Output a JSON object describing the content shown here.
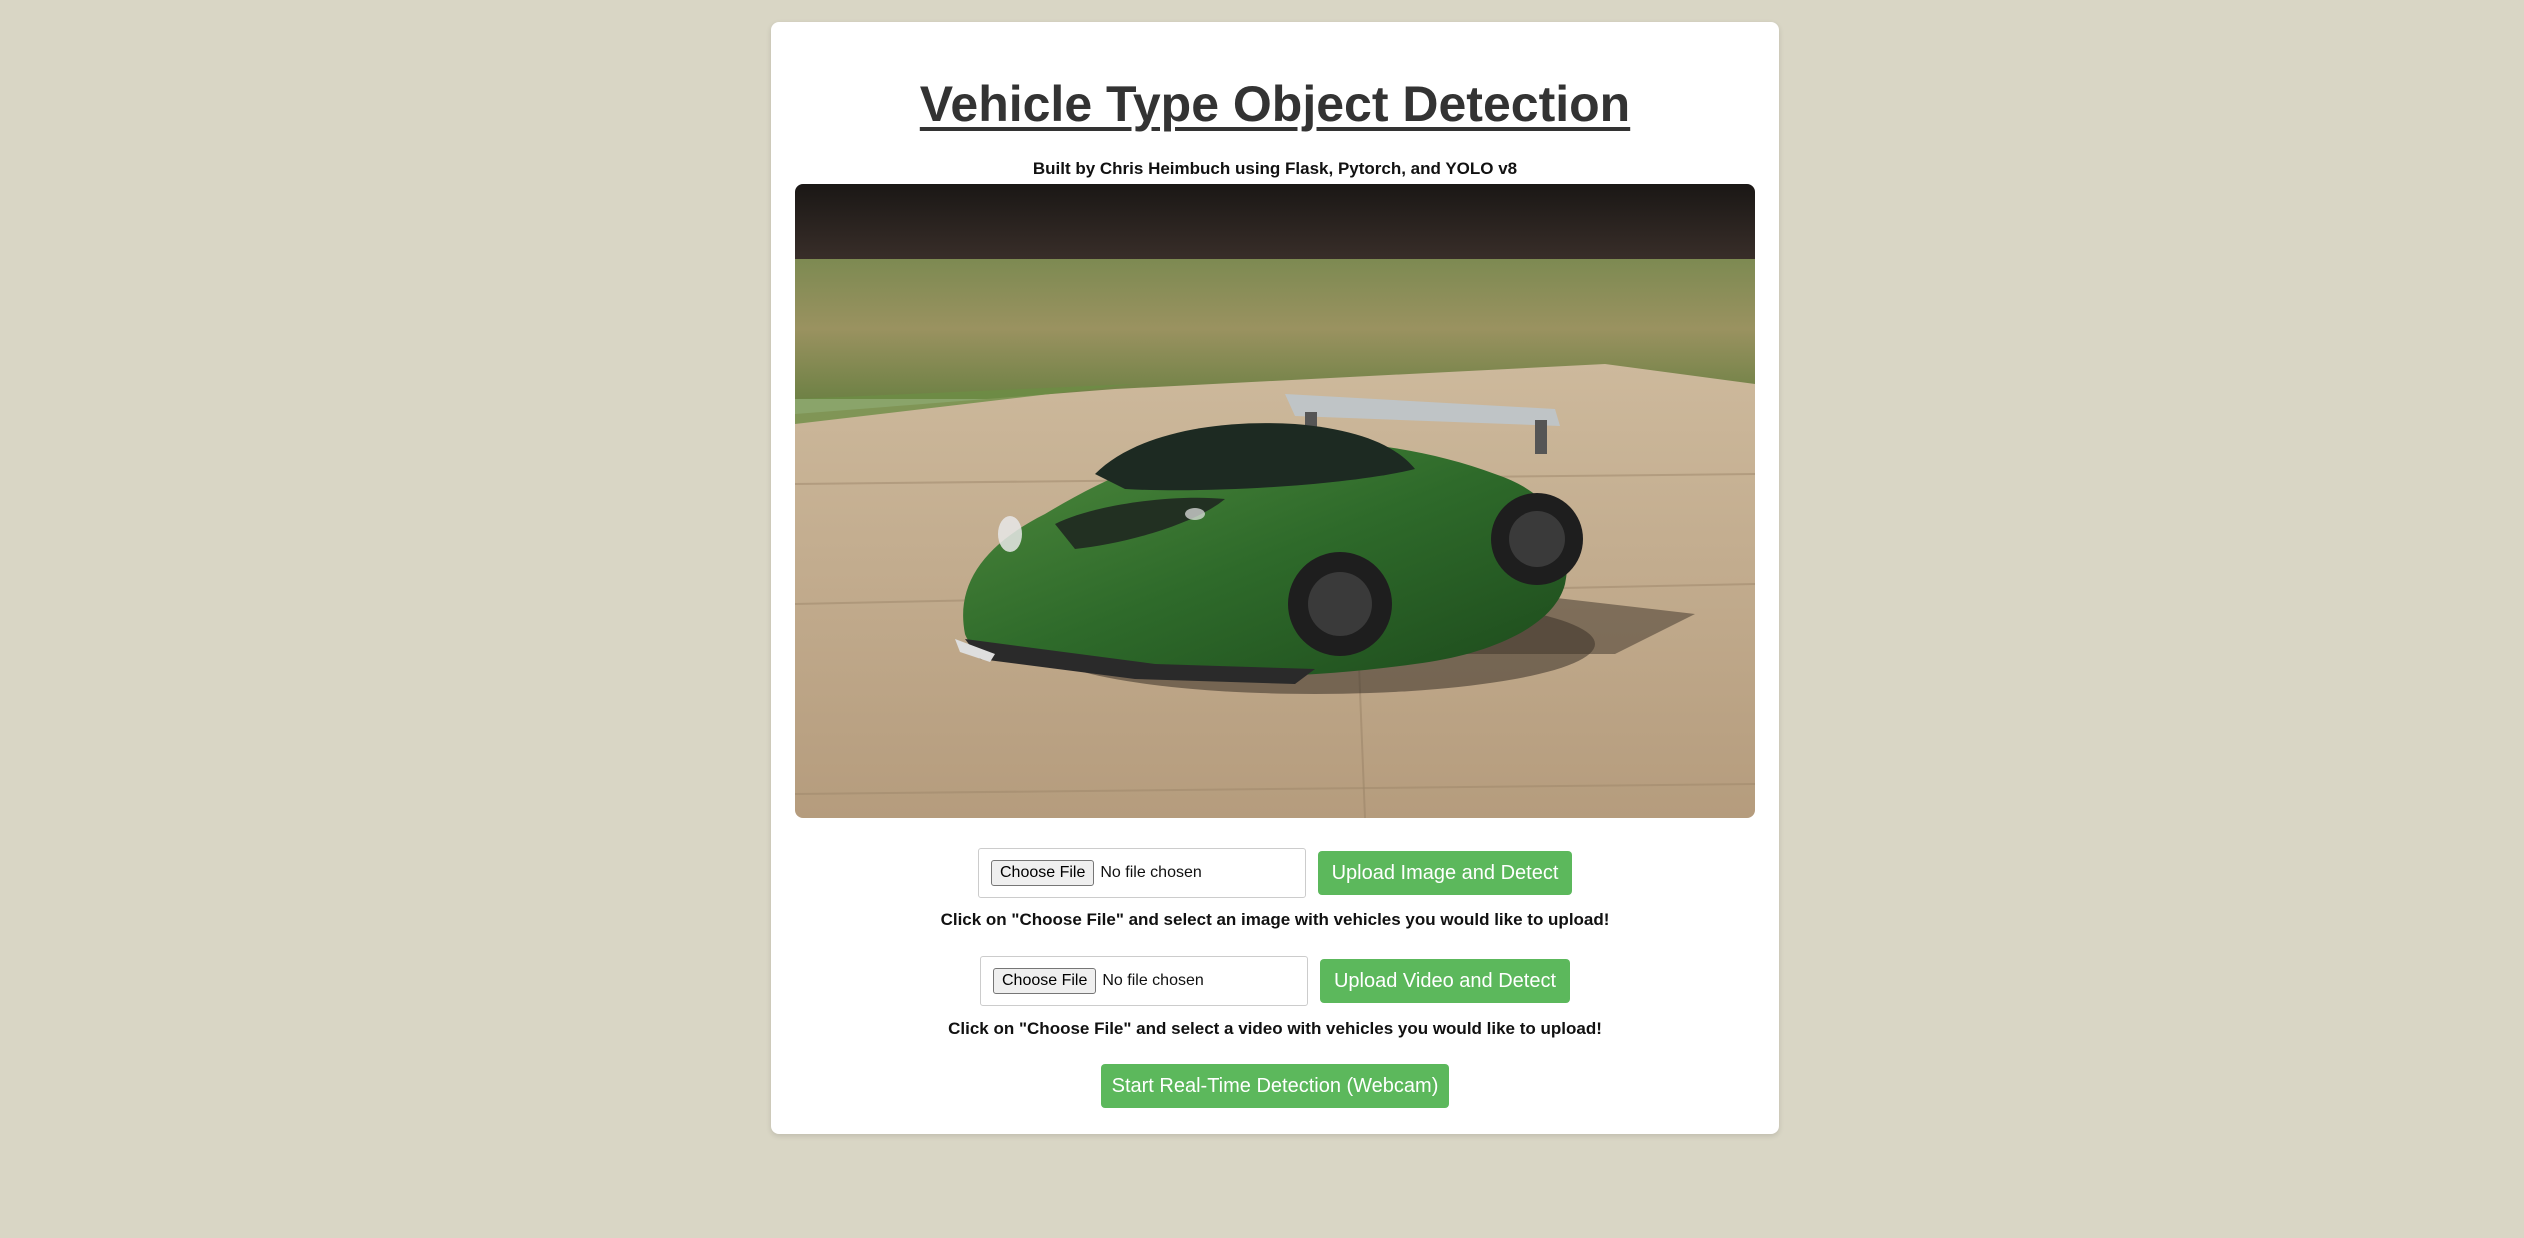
{
  "header": {
    "title": "Vehicle Type Object Detection",
    "subtitle": "Built by Chris Heimbuch using Flask, Pytorch, and YOLO v8"
  },
  "hero_image": {
    "subject": "green sports car on concrete pad"
  },
  "image_upload": {
    "choose_label": "Choose File",
    "file_status": "No file chosen",
    "button_label": "Upload Image and Detect",
    "hint": "Click on \"Choose File\" and select an image with vehicles you would like to upload!"
  },
  "video_upload": {
    "choose_label": "Choose File",
    "file_status": "No file chosen",
    "button_label": "Upload Video and Detect",
    "hint": "Click on \"Choose File\" and select a video with vehicles you would like to upload!"
  },
  "webcam": {
    "button_label": "Start Real-Time Detection (Webcam)"
  },
  "colors": {
    "background": "#d9d6c5",
    "card": "#ffffff",
    "accent_green": "#5cb85c",
    "title_text": "#333333"
  }
}
